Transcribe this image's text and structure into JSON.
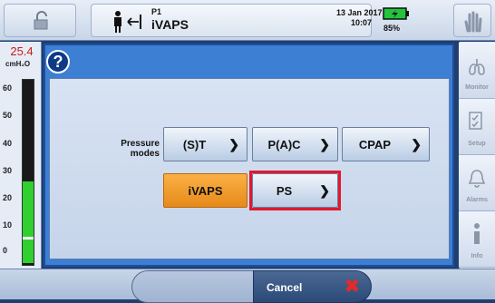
{
  "header": {
    "patient_id": "P1",
    "mode": "iVAPS",
    "date": "13 Jan 2017",
    "time": "10:07",
    "battery_percent": "85%"
  },
  "gauge": {
    "value": "25.4",
    "unit": "cmH₂O",
    "ticks": [
      "60",
      "50",
      "40",
      "30",
      "20",
      "10",
      "0"
    ]
  },
  "dialog": {
    "pressure_label": "Pressure modes",
    "buttons": {
      "st": "(S)T",
      "pac": "P(A)C",
      "cpap": "CPAP",
      "ivaps": "iVAPS",
      "ps": "PS"
    }
  },
  "sidebar": {
    "items": [
      {
        "label": "Monitor",
        "icon": "lungs-icon"
      },
      {
        "label": "Setup",
        "icon": "checklist-icon"
      },
      {
        "label": "Alarms",
        "icon": "bell-icon"
      },
      {
        "label": "Info",
        "icon": "info-icon"
      }
    ]
  },
  "footer": {
    "cancel_label": "Cancel"
  },
  "colors": {
    "accent_orange": "#f4a13a",
    "highlight_red": "#e3182d",
    "battery_green": "#22c53c"
  }
}
